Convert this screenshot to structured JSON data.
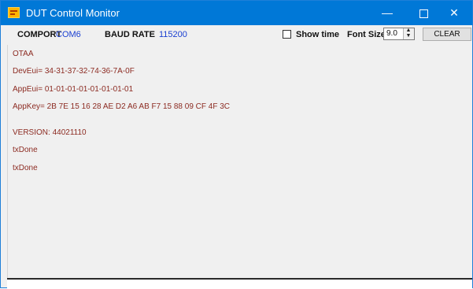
{
  "window": {
    "title": "DUT Control Monitor",
    "controls": {
      "minimize": "—",
      "close": "✕"
    }
  },
  "toolbar": {
    "comport_label": "COMPORT",
    "comport_value": "COM6",
    "baud_label": "BAUD RATE",
    "baud_value": "115200",
    "show_time_label": "Show time",
    "show_time_checked": false,
    "font_size_label": "Font Size",
    "font_size_value": "9.0",
    "clear_label": "CLEAR"
  },
  "log": {
    "lines": [
      "OTAA",
      "DevEui= 34-31-37-32-74-36-7A-0F",
      "AppEui= 01-01-01-01-01-01-01-01",
      "AppKey= 2B 7E 15 16 28 AE D2 A6 AB F7 15 88 09 CF 4F 3C",
      "VERSION: 44021110",
      "txDone",
      "txDone"
    ]
  },
  "colors": {
    "titlebar": "#0078d7",
    "log_text": "#8c2b22",
    "value_text": "#1a3fd1"
  }
}
